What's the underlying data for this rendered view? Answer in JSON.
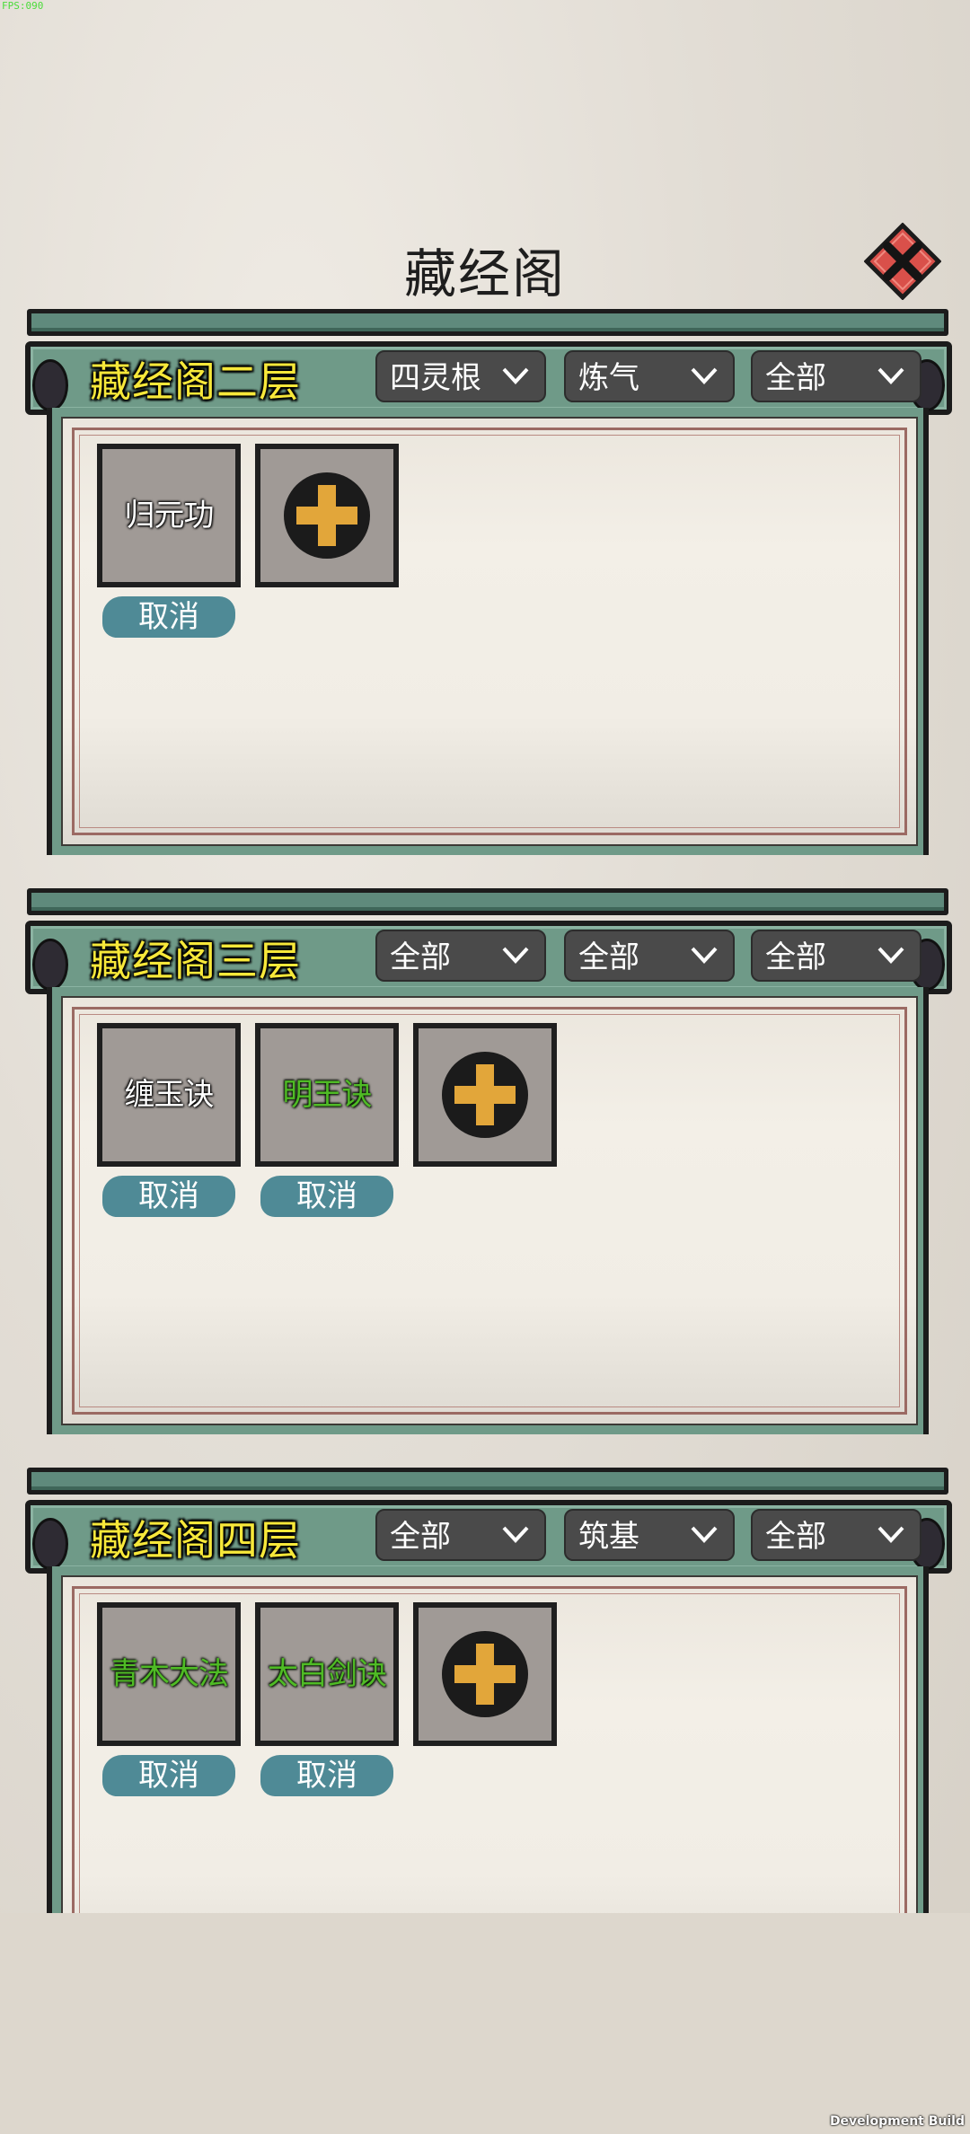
{
  "fps": "FPS:090",
  "title": "藏经阁",
  "dev_build": "Development Build",
  "sections": [
    {
      "floor": "藏经阁二层",
      "filters": [
        "四灵根",
        "炼气",
        "全部"
      ],
      "books": [
        {
          "name": "归元功",
          "color": "white",
          "action": "取消"
        }
      ]
    },
    {
      "floor": "藏经阁三层",
      "filters": [
        "全部",
        "全部",
        "全部"
      ],
      "books": [
        {
          "name": "缠玉诀",
          "color": "white",
          "action": "取消"
        },
        {
          "name": "明王诀",
          "color": "green",
          "action": "取消"
        }
      ]
    },
    {
      "floor": "藏经阁四层",
      "filters": [
        "全部",
        "筑基",
        "全部"
      ],
      "books": [
        {
          "name": "青木大法",
          "color": "green",
          "action": "取消"
        },
        {
          "name": "太白剑诀",
          "color": "green",
          "action": "取消"
        }
      ]
    }
  ],
  "icons": {
    "close": "close-x-icon",
    "add": "plus-icon",
    "dropdown": "chevron-down-icon"
  }
}
